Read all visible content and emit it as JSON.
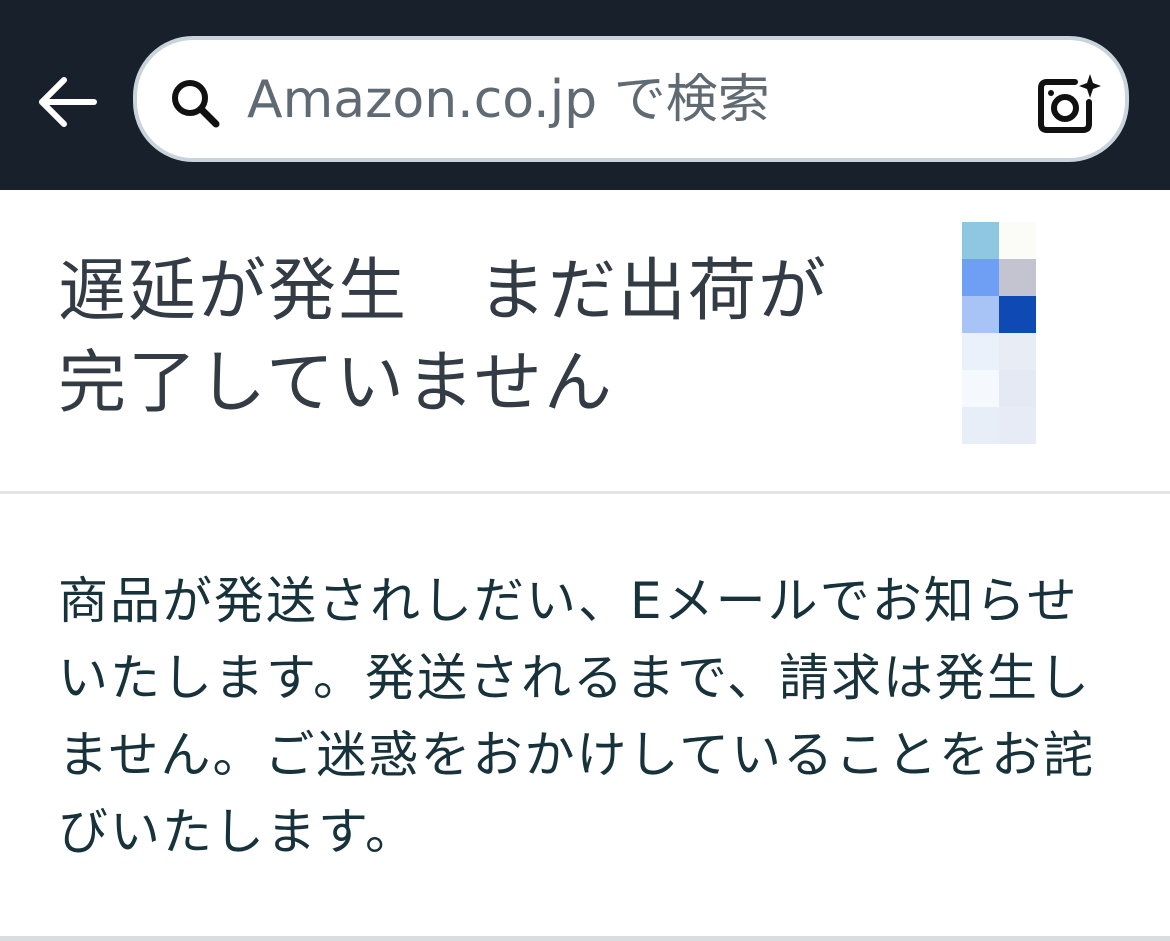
{
  "header": {
    "search": {
      "placeholder": "Amazon.co.jp で検索"
    },
    "icons": {
      "back": "arrow-left-icon",
      "search": "search-icon",
      "camera": "camera-sparkle-icon"
    },
    "background_color": "#17202b"
  },
  "status": {
    "title": "遅延が発生　まだ出荷が完了していません"
  },
  "message": {
    "body": "商品が発送されしだい、Eメールでお知らせいたします。発送されるまで、請求は発生しません。ご迷惑をおかけしていることをお詫びいたします。"
  },
  "colors": {
    "title_text": "#333b45",
    "body_text": "#17323a",
    "divider": "#e3e6e8"
  }
}
